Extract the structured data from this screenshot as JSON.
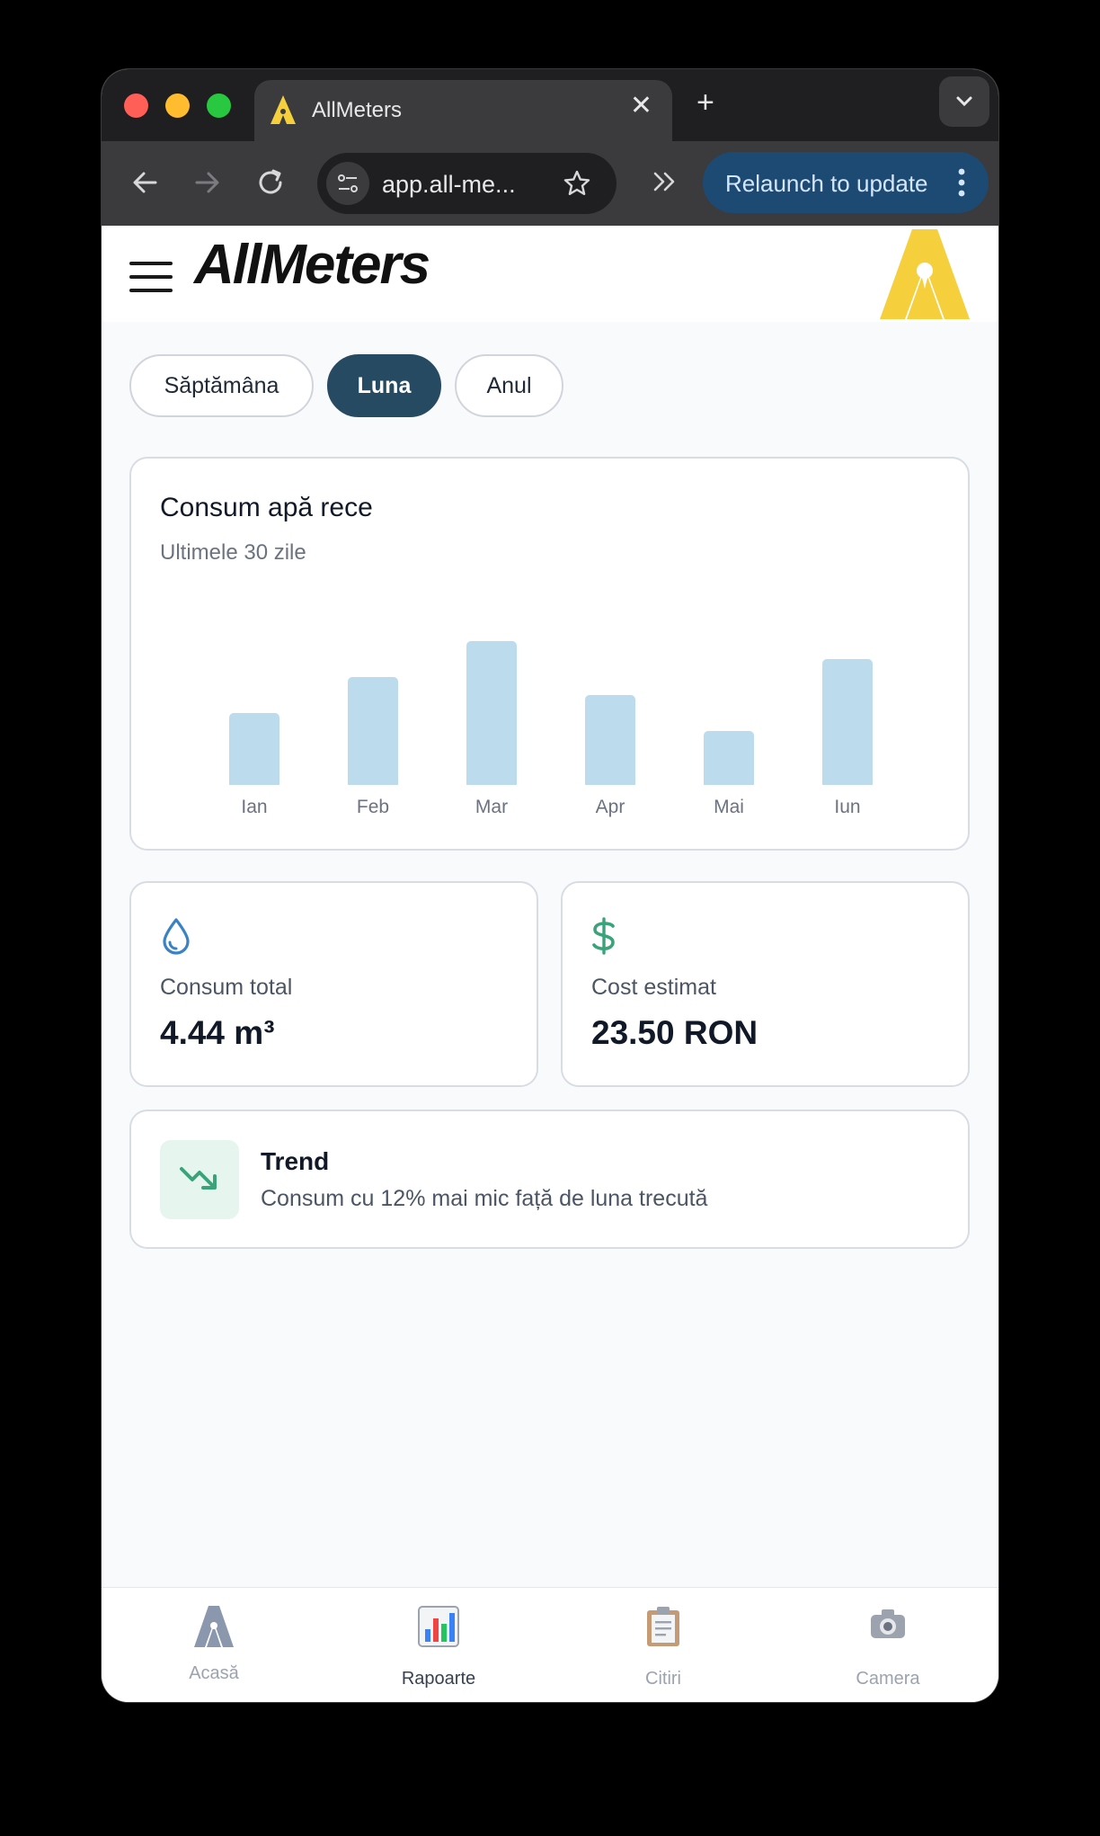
{
  "browser": {
    "tab_title": "AllMeters",
    "new_tab": "+",
    "close": "✕",
    "url": "app.all-me...",
    "relaunch_label": "Relaunch to update"
  },
  "header": {
    "logo_text": "AllMeters"
  },
  "period_tabs": [
    {
      "label": "Săptămâna",
      "active": false
    },
    {
      "label": "Luna",
      "active": true
    },
    {
      "label": "Anul",
      "active": false
    }
  ],
  "chart_card": {
    "title": "Consum apă rece",
    "subtitle": "Ultimele 30 zile"
  },
  "chart_data": {
    "type": "bar",
    "categories": [
      "Ian",
      "Feb",
      "Mar",
      "Apr",
      "Mai",
      "Iun"
    ],
    "values": [
      40,
      60,
      80,
      50,
      30,
      70
    ],
    "ylim": [
      0,
      100
    ],
    "grid": false,
    "bar_color": "#bcdcee",
    "title": "Consum apă rece",
    "subtitle": "Ultimele 30 zile",
    "xlabel": "",
    "ylabel": ""
  },
  "stats": {
    "total": {
      "icon": "water-drop-icon",
      "label": "Consum total",
      "value": "4.44 m³"
    },
    "cost": {
      "icon": "dollar-icon",
      "label": "Cost estimat",
      "value": "23.50 RON"
    }
  },
  "trend": {
    "icon": "trending-down-icon",
    "title": "Trend",
    "text": "Consum cu 12% mai mic față de luna trecută"
  },
  "bottom_nav": [
    {
      "label": "Acasă",
      "icon": "home-logo-icon",
      "active": false
    },
    {
      "label": "Rapoarte",
      "icon": "bar-chart-icon",
      "active": true
    },
    {
      "label": "Citiri",
      "icon": "clipboard-icon",
      "active": false
    },
    {
      "label": "Camera",
      "icon": "camera-icon",
      "active": false
    }
  ],
  "colors": {
    "accent": "#274a63",
    "brand_yellow": "#f5cf3c",
    "bar": "#bcdcee",
    "trend_green": "#3aa37a",
    "relaunch": "#1d4a73"
  }
}
